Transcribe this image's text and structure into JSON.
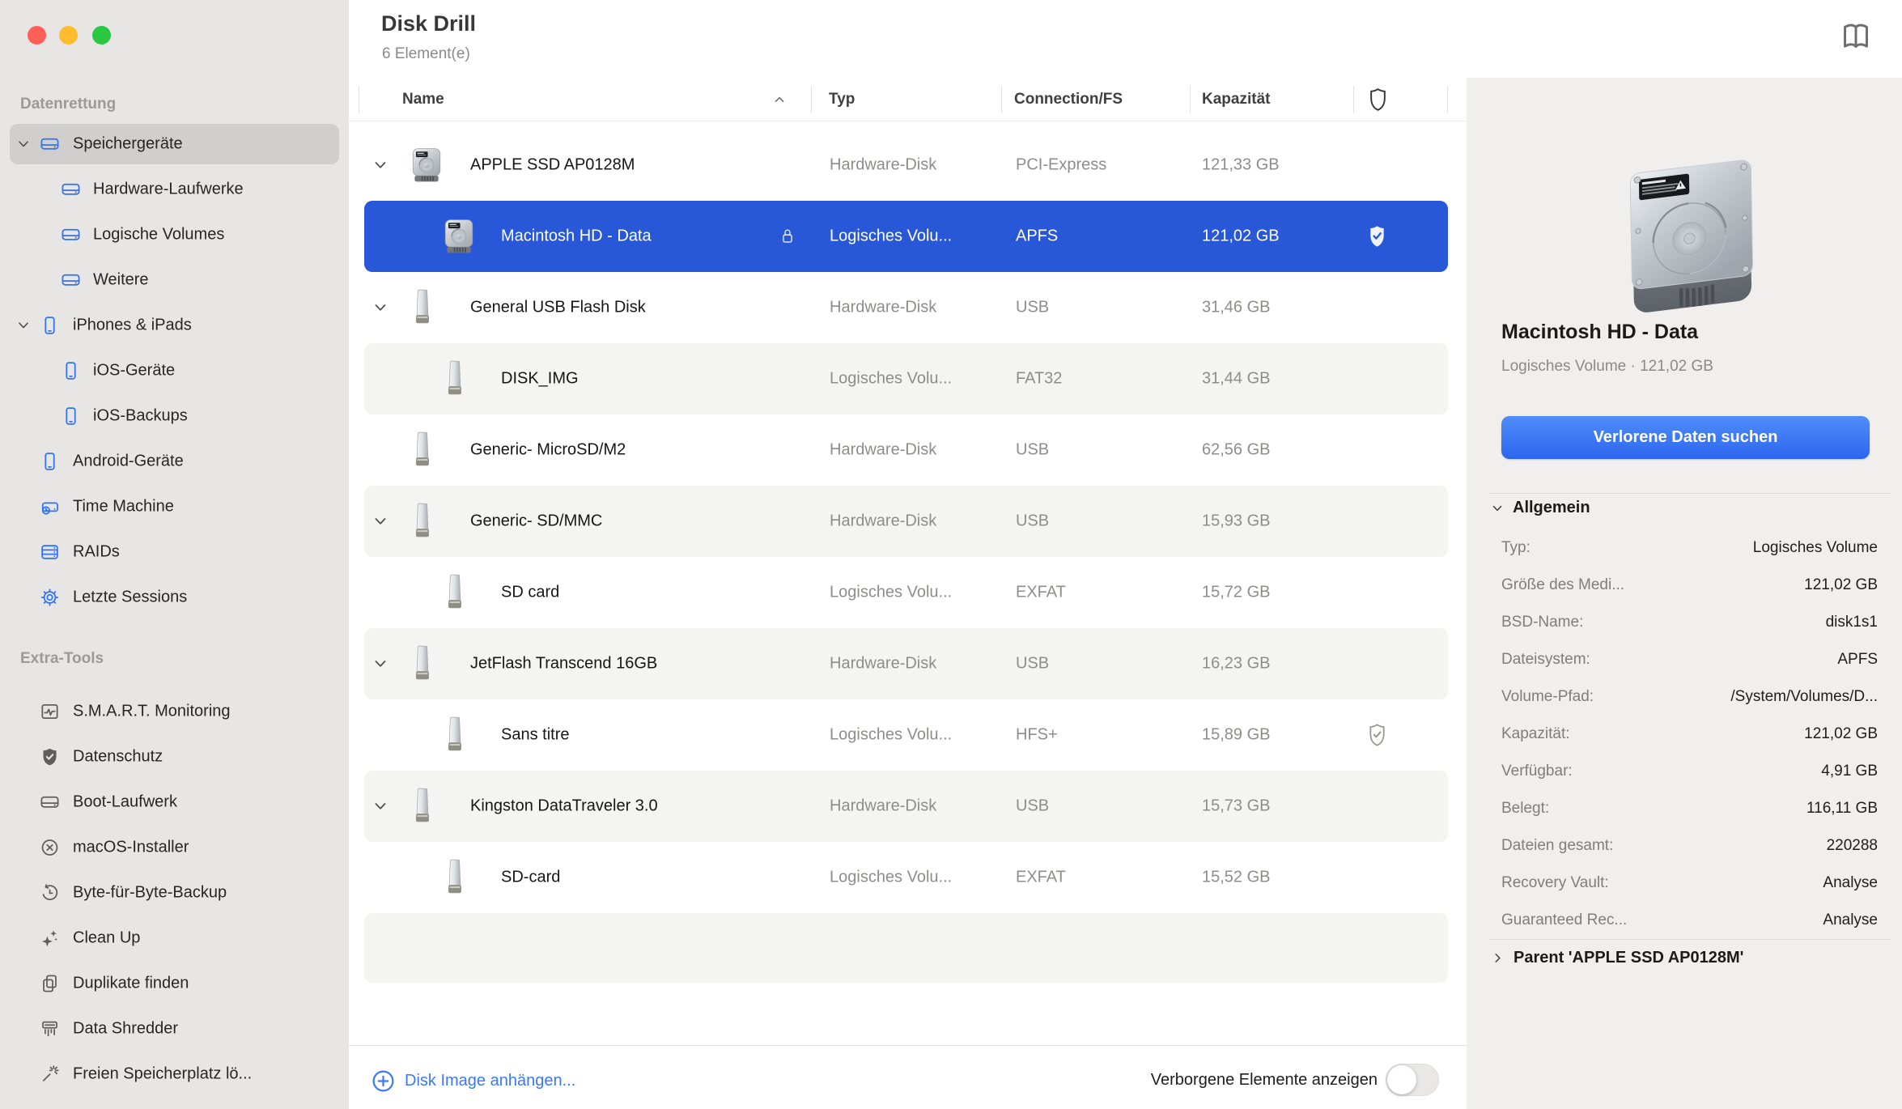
{
  "window": {
    "title": "Disk Drill",
    "items_count": "6 Element(e)"
  },
  "colors": {
    "selection_blue": "#2857d8",
    "accent_blue": "#3173f4",
    "sidebar_bg": "#e7e6e4",
    "sidebar_selected": "#d0cfcd",
    "row_alt": "#f4f4f2",
    "panel_bg": "#f0efed",
    "traffic_red": "#ff5f57",
    "traffic_yellow": "#febc2e",
    "traffic_green": "#28c840"
  },
  "sidebar": {
    "sections": [
      {
        "label": "Datenrettung",
        "items": [
          {
            "label": "Speichergeräte",
            "icon": "drive-icon",
            "selected": true,
            "expanded": true
          },
          {
            "label": "Hardware-Laufwerke",
            "icon": "drive-icon"
          },
          {
            "label": "Logische Volumes",
            "icon": "drive-icon"
          },
          {
            "label": "Weitere",
            "icon": "drive-icon"
          },
          {
            "label": "iPhones & iPads",
            "icon": "phone-icon",
            "expanded": true
          },
          {
            "label": "iOS-Geräte",
            "icon": "phone-icon"
          },
          {
            "label": "iOS-Backups",
            "icon": "phone-icon"
          },
          {
            "label": "Android-Geräte",
            "icon": "phone-icon"
          },
          {
            "label": "Time Machine",
            "icon": "time-machine-icon"
          },
          {
            "label": "RAIDs",
            "icon": "raid-icon"
          },
          {
            "label": "Letzte Sessions",
            "icon": "gear-icon"
          }
        ]
      },
      {
        "label": "Extra-Tools",
        "items": [
          {
            "label": "S.M.A.R.T. Monitoring",
            "icon": "monitor-icon"
          },
          {
            "label": "Datenschutz",
            "icon": "shield-check-icon"
          },
          {
            "label": "Boot-Laufwerk",
            "icon": "drive-icon"
          },
          {
            "label": "macOS-Installer",
            "icon": "circle-x-icon"
          },
          {
            "label": "Byte-für-Byte-Backup",
            "icon": "history-icon"
          },
          {
            "label": "Clean Up",
            "icon": "sparkles-icon"
          },
          {
            "label": "Duplikate finden",
            "icon": "documents-icon"
          },
          {
            "label": "Data Shredder",
            "icon": "shredder-icon"
          },
          {
            "label": "Freien Speicherplatz lö...",
            "icon": "wand-icon"
          }
        ]
      }
    ]
  },
  "table": {
    "columns": [
      "Name",
      "Typ",
      "Connection/FS",
      "Kapazität"
    ],
    "rows": [
      {
        "name": "APPLE SSD AP0128M",
        "type": "Hardware-Disk",
        "fs": "PCI-Express",
        "capacity": "121,33 GB"
      },
      {
        "name": "Macintosh HD - Data",
        "type": "Logisches Volu...",
        "fs": "APFS",
        "capacity": "121,02 GB"
      },
      {
        "name": "General USB Flash Disk",
        "type": "Hardware-Disk",
        "fs": "USB",
        "capacity": "31,46 GB"
      },
      {
        "name": "DISK_IMG",
        "type": "Logisches Volu...",
        "fs": "FAT32",
        "capacity": "31,44 GB"
      },
      {
        "name": "Generic- MicroSD/M2",
        "type": "Hardware-Disk",
        "fs": "USB",
        "capacity": "62,56 GB"
      },
      {
        "name": "Generic- SD/MMC",
        "type": "Hardware-Disk",
        "fs": "USB",
        "capacity": "15,93 GB"
      },
      {
        "name": "SD card",
        "type": "Logisches Volu...",
        "fs": "EXFAT",
        "capacity": "15,72 GB"
      },
      {
        "name": "JetFlash Transcend 16GB",
        "type": "Hardware-Disk",
        "fs": "USB",
        "capacity": "16,23 GB"
      },
      {
        "name": "Sans titre",
        "type": "Logisches Volu...",
        "fs": "HFS+",
        "capacity": "15,89 GB"
      },
      {
        "name": "Kingston DataTraveler 3.0",
        "type": "Hardware-Disk",
        "fs": "USB",
        "capacity": "15,73 GB"
      },
      {
        "name": "SD-card",
        "type": "Logisches Volu...",
        "fs": "EXFAT",
        "capacity": "15,52 GB"
      }
    ]
  },
  "footer": {
    "attach_link": "Disk Image anhängen...",
    "toggle_label": "Verborgene Elemente anzeigen",
    "toggle_on": false
  },
  "inspector": {
    "title": "Macintosh HD - Data",
    "subtitle": "Logisches Volume · 121,02 GB",
    "action_button": "Verlorene Daten suchen",
    "section": "Allgemein",
    "details": [
      {
        "label": "Typ:",
        "value": "Logisches Volume"
      },
      {
        "label": "Größe des Medi...",
        "value": "121,02 GB"
      },
      {
        "label": "BSD-Name:",
        "value": "disk1s1"
      },
      {
        "label": "Dateisystem:",
        "value": "APFS"
      },
      {
        "label": "Volume-Pfad:",
        "value": "/System/Volumes/D..."
      },
      {
        "label": "Kapazität:",
        "value": "121,02 GB"
      },
      {
        "label": "Verfügbar:",
        "value": "4,91 GB"
      },
      {
        "label": "Belegt:",
        "value": "116,11 GB"
      },
      {
        "label": "Dateien gesamt:",
        "value": "220288"
      },
      {
        "label": "Recovery Vault:",
        "value": "Analyse"
      },
      {
        "label": "Guaranteed Rec...",
        "value": "Analyse"
      }
    ],
    "parent": "Parent 'APPLE SSD AP0128M'"
  }
}
